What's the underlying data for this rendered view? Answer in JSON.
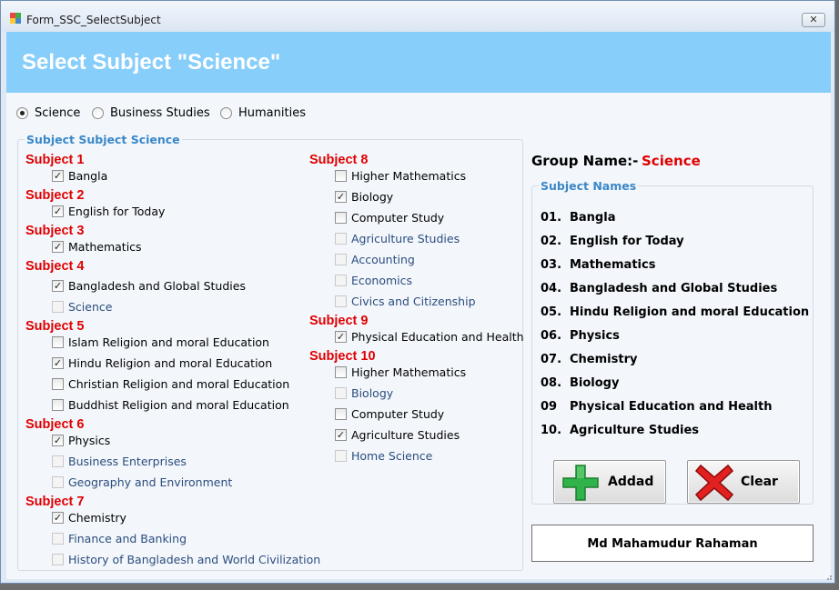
{
  "window": {
    "title": "Form_SSC_SelectSubject",
    "close_label": "✕"
  },
  "header": {
    "title": "Select Subject \"Science\""
  },
  "group_selector": {
    "options": [
      {
        "label": "Science",
        "selected": true
      },
      {
        "label": "Business Studies",
        "selected": false
      },
      {
        "label": "Humanities",
        "selected": false
      }
    ]
  },
  "subjects_panel": {
    "legend": "Subject Subject Science",
    "sections": [
      {
        "heading": "Subject 1",
        "items": [
          {
            "label": "Bangla",
            "checked": true,
            "enabled": true
          }
        ]
      },
      {
        "heading": "Subject 2",
        "items": [
          {
            "label": "English for Today",
            "checked": true,
            "enabled": true
          }
        ]
      },
      {
        "heading": "Subject 3",
        "items": [
          {
            "label": "Mathematics",
            "checked": true,
            "enabled": true
          }
        ]
      },
      {
        "heading": "Subject 4",
        "items": [
          {
            "label": "Bangladesh and Global Studies",
            "checked": true,
            "enabled": true
          },
          {
            "label": "Science",
            "checked": false,
            "enabled": false
          }
        ]
      },
      {
        "heading": "Subject 5",
        "items": [
          {
            "label": "Islam Religion and moral Education",
            "checked": false,
            "enabled": true
          },
          {
            "label": "Hindu Religion and moral Education",
            "checked": true,
            "enabled": true
          },
          {
            "label": "Christian Religion and moral Education",
            "checked": false,
            "enabled": true
          },
          {
            "label": "Buddhist Religion and moral Education",
            "checked": false,
            "enabled": true
          }
        ]
      },
      {
        "heading": "Subject 6",
        "items": [
          {
            "label": "Physics",
            "checked": true,
            "enabled": true
          },
          {
            "label": "Business Enterprises",
            "checked": false,
            "enabled": false
          },
          {
            "label": "Geography and Environment",
            "checked": false,
            "enabled": false
          }
        ]
      },
      {
        "heading": "Subject 7",
        "items": [
          {
            "label": "Chemistry",
            "checked": true,
            "enabled": true
          },
          {
            "label": "Finance and Banking",
            "checked": false,
            "enabled": false
          },
          {
            "label": "History of Bangladesh and World Civilization",
            "checked": false,
            "enabled": false
          }
        ]
      },
      {
        "heading": "Subject 8",
        "items": [
          {
            "label": "Higher Mathematics",
            "checked": false,
            "enabled": true
          },
          {
            "label": "Biology",
            "checked": true,
            "enabled": true
          },
          {
            "label": "Computer Study",
            "checked": false,
            "enabled": true
          },
          {
            "label": "Agriculture Studies",
            "checked": false,
            "enabled": false
          },
          {
            "label": "Accounting",
            "checked": false,
            "enabled": false
          },
          {
            "label": "Economics",
            "checked": false,
            "enabled": false
          },
          {
            "label": "Civics and Citizenship",
            "checked": false,
            "enabled": false
          }
        ]
      },
      {
        "heading": "Subject 9",
        "items": [
          {
            "label": "Physical Education and Health",
            "checked": true,
            "enabled": true
          }
        ]
      },
      {
        "heading": "Subject 10",
        "items": [
          {
            "label": "Higher Mathematics",
            "checked": false,
            "enabled": true
          },
          {
            "label": "Biology",
            "checked": false,
            "enabled": false
          },
          {
            "label": "Computer Study",
            "checked": false,
            "enabled": true
          },
          {
            "label": "Agriculture Studies",
            "checked": true,
            "enabled": true
          },
          {
            "label": "Home Science",
            "checked": false,
            "enabled": false
          }
        ]
      }
    ]
  },
  "group_name": {
    "label": "Group Name:-",
    "value": "Science"
  },
  "subject_names": {
    "legend": "Subject Names",
    "items": [
      {
        "num": "01.",
        "name": "Bangla"
      },
      {
        "num": "02.",
        "name": "English for Today"
      },
      {
        "num": "03.",
        "name": "Mathematics"
      },
      {
        "num": "04.",
        "name": "Bangladesh and Global Studies"
      },
      {
        "num": "05.",
        "name": "Hindu Religion and moral Education"
      },
      {
        "num": "06.",
        "name": "Physics"
      },
      {
        "num": "07.",
        "name": "Chemistry"
      },
      {
        "num": "08.",
        "name": "Biology"
      },
      {
        "num": "09",
        "name": "Physical Education and Health"
      },
      {
        "num": "10.",
        "name": "Agriculture Studies"
      }
    ]
  },
  "buttons": {
    "add_label": "Addad",
    "clear_label": "Clear"
  },
  "footer": {
    "author": "Md Mahamudur Rahaman"
  },
  "colors": {
    "header_band": "#87cefa",
    "subject_heading": "#e00000",
    "legend": "#3a87c8",
    "disabled_text": "#2b4c7c"
  },
  "icons": {
    "add": "green-plus-icon",
    "clear": "red-x-icon"
  }
}
